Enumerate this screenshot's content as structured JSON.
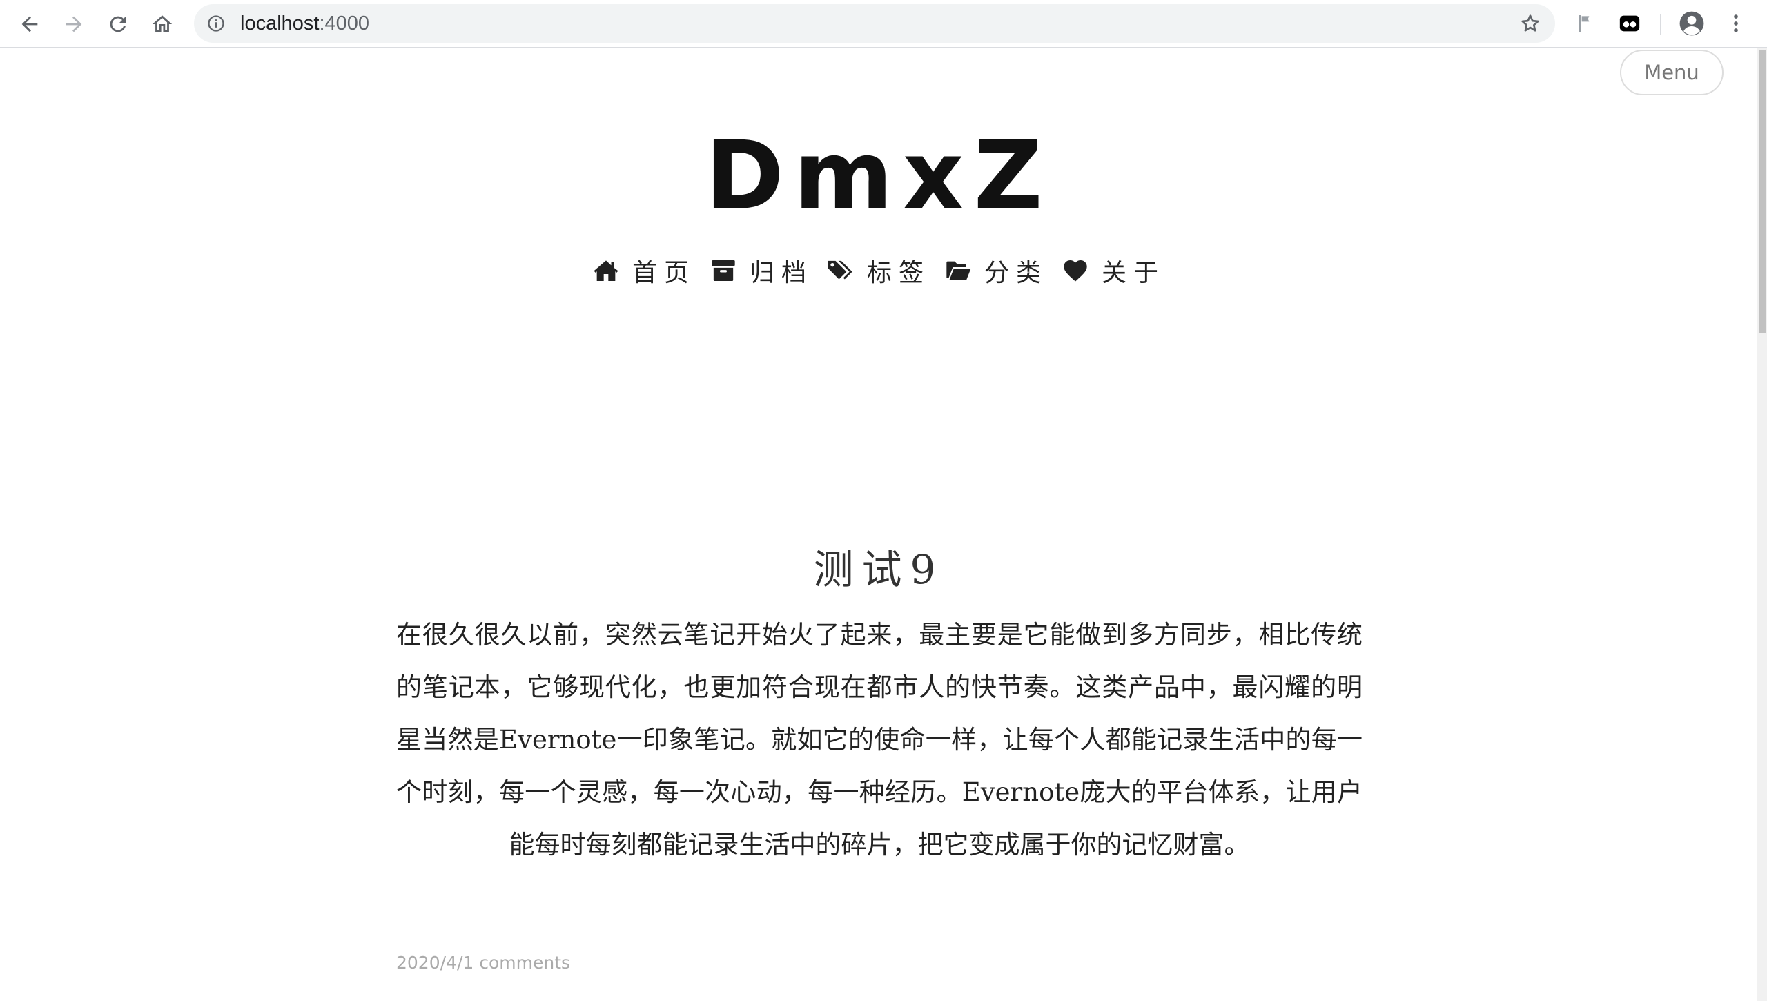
{
  "browser": {
    "url_host": "localhost",
    "url_port": ":4000",
    "icons": [
      "back-arrow-icon",
      "forward-arrow-icon",
      "reload-icon",
      "home-icon",
      "info-icon",
      "star-icon",
      "flag-icon",
      "extension-icon",
      "profile-icon",
      "kebab-menu-icon"
    ]
  },
  "header": {
    "menu_label": "Menu",
    "site_title": "DmxZ"
  },
  "nav": {
    "items": [
      {
        "label": "首页",
        "icon": "home-icon"
      },
      {
        "label": "归档",
        "icon": "archive-icon"
      },
      {
        "label": "标签",
        "icon": "tags-icon"
      },
      {
        "label": "分类",
        "icon": "folder-open-icon"
      },
      {
        "label": "关于",
        "icon": "heart-icon"
      }
    ]
  },
  "post": {
    "title": "测试9",
    "excerpt": "在很久很久以前，突然云笔记开始火了起来，最主要是它能做到多方同步，相比传统的笔记本，它够现代化，也更加符合现在都市人的快节奏。这类产品中，最闪耀的明星当然是Evernote一印象笔记。就如它的使命一样，让每个人都能记录生活中的每一个时刻，每一个灵感，每一次心动，每一种经历。Evernote庞大的平台体系，让用户能每时每刻都能记录生活中的碎片，把它变成属于你的记忆财富。",
    "meta": "2020/4/1 comments"
  },
  "colors": {
    "chrome_border": "#dadce0",
    "omnibox_bg": "#f1f3f4",
    "title_color": "#111111",
    "meta_color": "#aaaaaa"
  }
}
